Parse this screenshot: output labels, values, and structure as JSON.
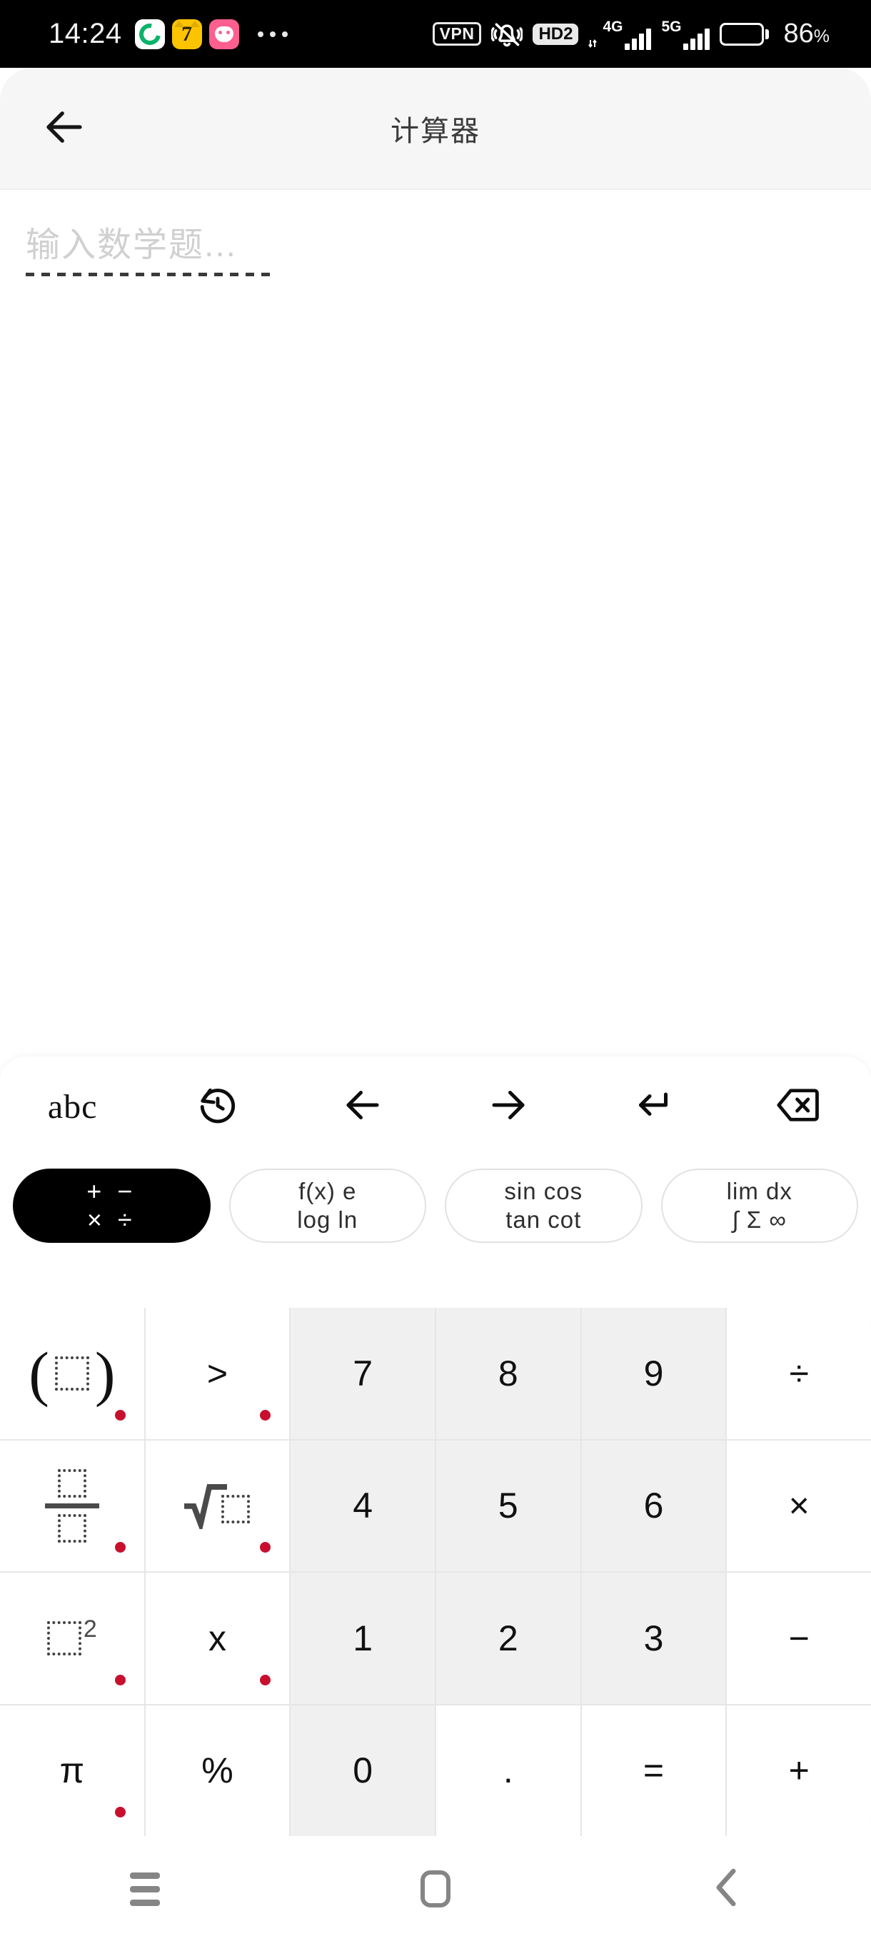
{
  "statusbar": {
    "time": "14:24",
    "app_icons": [
      "weixin-icon",
      "cat7-icon",
      "pink-cat-icon"
    ],
    "overflow_label": "more-indicator",
    "vpn_label": "VPN",
    "mute_icon": "bell-mute-icon",
    "hd_label": "HD2",
    "network_1": "4G",
    "network_2": "5G",
    "battery_percent": "86",
    "battery_percent_symbol": "%"
  },
  "header": {
    "back_icon": "arrow-left-icon",
    "title": "计算器"
  },
  "content": {
    "input_placeholder": "输入数学题...",
    "input_value": ""
  },
  "keyboard": {
    "toolbar": [
      {
        "name": "abc-button",
        "label": "abc"
      },
      {
        "name": "history-button",
        "label": "history-icon"
      },
      {
        "name": "cursor-left-button",
        "label": "arrow-left-icon"
      },
      {
        "name": "cursor-right-button",
        "label": "arrow-right-icon"
      },
      {
        "name": "enter-button",
        "label": "enter-return-icon"
      },
      {
        "name": "backspace-button",
        "label": "backspace-icon"
      }
    ],
    "chips": [
      {
        "name": "chip-basic-operators",
        "line1": "+ −",
        "line2": "× ÷",
        "active": true
      },
      {
        "name": "chip-functions",
        "line1": "f(x)  e",
        "line2": "log  ln",
        "active": false
      },
      {
        "name": "chip-trigonometry",
        "line1": "sin cos",
        "line2": "tan cot",
        "active": false
      },
      {
        "name": "chip-calculus",
        "line1": "lim  dx",
        "line2": "∫ Σ ∞",
        "active": false
      }
    ],
    "keys": [
      {
        "name": "key-parentheses",
        "label": "(□)",
        "type": "template",
        "style": "func",
        "dot": true
      },
      {
        "name": "key-greater-than",
        "label": ">",
        "type": "text",
        "style": "func",
        "dot": true
      },
      {
        "name": "key-7",
        "label": "7",
        "type": "text",
        "style": "num",
        "dot": false
      },
      {
        "name": "key-8",
        "label": "8",
        "type": "text",
        "style": "num",
        "dot": false
      },
      {
        "name": "key-9",
        "label": "9",
        "type": "text",
        "style": "num",
        "dot": false
      },
      {
        "name": "key-divide",
        "label": "÷",
        "type": "text",
        "style": "func",
        "dot": false
      },
      {
        "name": "key-fraction",
        "label": "□/□",
        "type": "template",
        "style": "func",
        "dot": true
      },
      {
        "name": "key-square-root",
        "label": "√□",
        "type": "template",
        "style": "func",
        "dot": true
      },
      {
        "name": "key-4",
        "label": "4",
        "type": "text",
        "style": "num",
        "dot": false
      },
      {
        "name": "key-5",
        "label": "5",
        "type": "text",
        "style": "num",
        "dot": false
      },
      {
        "name": "key-6",
        "label": "6",
        "type": "text",
        "style": "num",
        "dot": false
      },
      {
        "name": "key-multiply",
        "label": "×",
        "type": "text",
        "style": "func",
        "dot": false
      },
      {
        "name": "key-power",
        "label": "□²",
        "type": "template",
        "style": "func",
        "dot": true
      },
      {
        "name": "key-variable-x",
        "label": "x",
        "type": "text",
        "style": "func",
        "dot": true
      },
      {
        "name": "key-1",
        "label": "1",
        "type": "text",
        "style": "num",
        "dot": false
      },
      {
        "name": "key-2",
        "label": "2",
        "type": "text",
        "style": "num",
        "dot": false
      },
      {
        "name": "key-3",
        "label": "3",
        "type": "text",
        "style": "num",
        "dot": false
      },
      {
        "name": "key-minus",
        "label": "−",
        "type": "text",
        "style": "func",
        "dot": false
      },
      {
        "name": "key-pi",
        "label": "π",
        "type": "text",
        "style": "func",
        "dot": true
      },
      {
        "name": "key-percent",
        "label": "%",
        "type": "text",
        "style": "func",
        "dot": false
      },
      {
        "name": "key-0",
        "label": "0",
        "type": "text",
        "style": "num",
        "dot": false
      },
      {
        "name": "key-decimal-point",
        "label": ".",
        "type": "text",
        "style": "func",
        "dot": false
      },
      {
        "name": "key-equals",
        "label": "=",
        "type": "text",
        "style": "func",
        "dot": false
      },
      {
        "name": "key-plus",
        "label": "+",
        "type": "text",
        "style": "func",
        "dot": false
      }
    ]
  },
  "navbar": [
    {
      "name": "nav-recents-button",
      "icon": "hamburger-icon"
    },
    {
      "name": "nav-home-button",
      "icon": "home-square-icon"
    },
    {
      "name": "nav-back-button",
      "icon": "chevron-left-icon"
    }
  ],
  "colors": {
    "accent_dot": "#c8102e",
    "chip_active_bg": "#000000",
    "num_key_bg": "#f0f0f0",
    "header_bg": "#f6f6f6"
  }
}
